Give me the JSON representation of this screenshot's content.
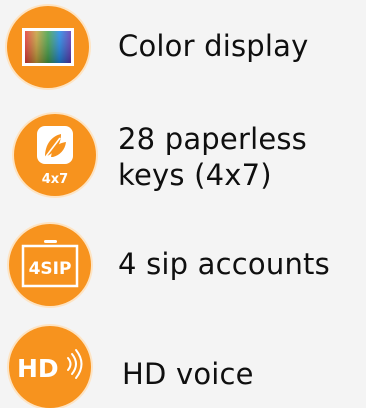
{
  "features": [
    {
      "icon": "color-display-icon",
      "label_lines": [
        "Color display"
      ]
    },
    {
      "icon": "paperless-keys-icon",
      "badge_text": "4x7",
      "label_lines": [
        "28 paperless",
        "keys (4x7)"
      ]
    },
    {
      "icon": "sip-accounts-icon",
      "badge_text": "4SIP",
      "label_lines": [
        "4 sip accounts"
      ]
    },
    {
      "icon": "hd-voice-icon",
      "badge_text": "HD",
      "label_lines": [
        "HD voice"
      ]
    }
  ],
  "colors": {
    "background": "#f4f4f4",
    "badge_orange": "#f7931e",
    "text": "#0f0f0f",
    "icon_white": "#ffffff"
  }
}
